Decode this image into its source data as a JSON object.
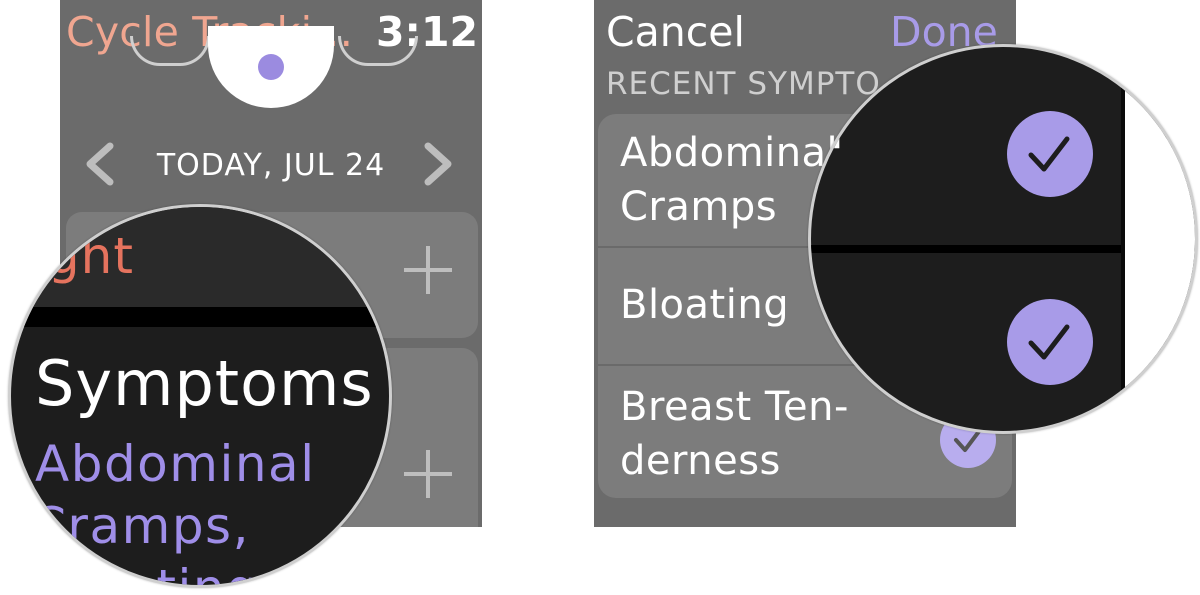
{
  "left": {
    "app_title": "Cycle Tracki…",
    "time": "3:12",
    "date": "TODAY, JUL 24",
    "prev_icon": "chevron-left-icon",
    "next_icon": "chevron-right-icon",
    "add_icon": "plus-icon",
    "magnifier": {
      "weight_partial": "ight",
      "symptoms_title": "Symptoms",
      "symptoms_line1": "Abdominal",
      "symptoms_line2": "Cramps,",
      "symptoms_line3": "Bloating"
    }
  },
  "right": {
    "cancel_label": "Cancel",
    "done_label": "Done",
    "section_label": "RECENT SYMPTO",
    "items": [
      {
        "label_line1": "Abdominal",
        "label_line2": "Cramps",
        "checked": true
      },
      {
        "label_line1": "Bloating",
        "label_line2": "",
        "checked": true
      },
      {
        "label_line1": "Breast Ten-",
        "label_line2": "derness",
        "checked": true
      }
    ],
    "magnifier_partial": "l"
  },
  "colors": {
    "accent_purple": "#a89be8",
    "title_salmon": "#f0a690",
    "weight_orange": "#e5735e"
  }
}
